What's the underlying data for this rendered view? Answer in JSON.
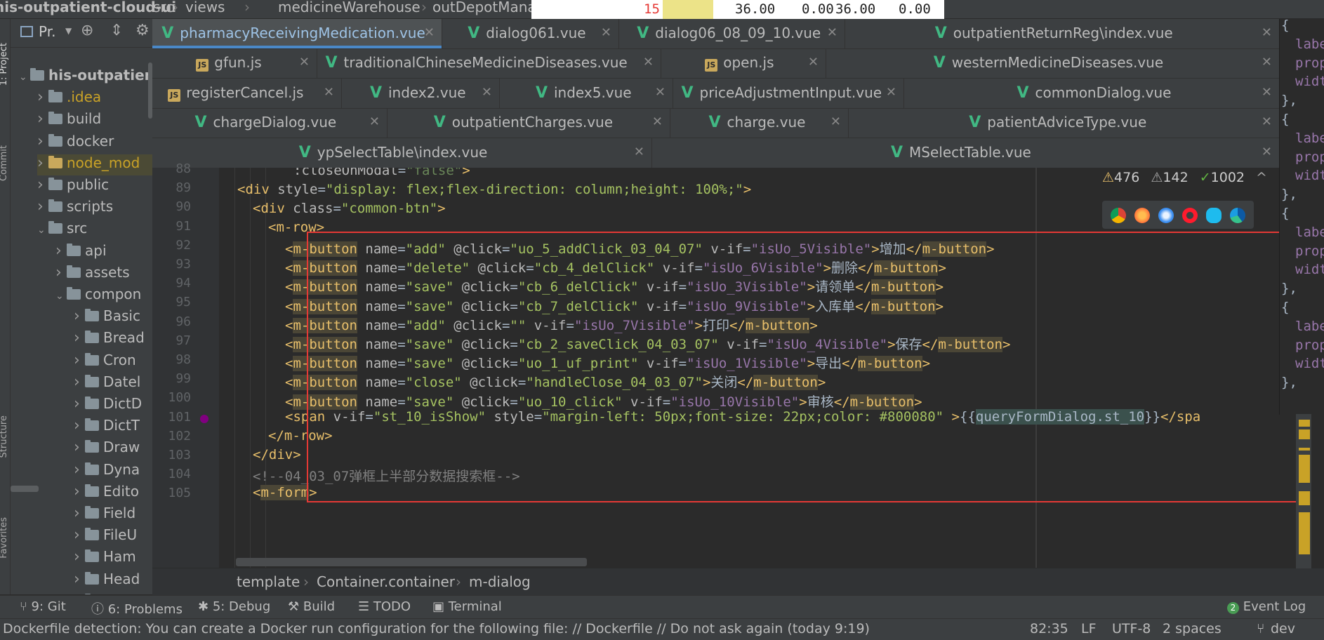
{
  "breadcrumb": [
    "his-outpatient-cloud-ui",
    "src",
    "views",
    "medicineWarehouse",
    "outDepotMana"
  ],
  "popup_row": {
    "num": "15",
    "v1": "36.00",
    "v2": "0.00",
    "v3": "36.00",
    "v4": "0.00"
  },
  "left_strip": {
    "project": "1: Project",
    "commit": "Commit",
    "structure": "Structure",
    "favorites": "Favorites"
  },
  "project_panel": {
    "title": "Pr.",
    "items": [
      {
        "label": "his-outpatien",
        "arrow": "down",
        "indent": 0,
        "color": "root"
      },
      {
        "label": ".idea",
        "arrow": "right",
        "indent": 1,
        "color": "yellow"
      },
      {
        "label": "build",
        "arrow": "right",
        "indent": 1,
        "color": "normal"
      },
      {
        "label": "docker",
        "arrow": "right",
        "indent": 1,
        "color": "normal"
      },
      {
        "label": "node_mod",
        "arrow": "right",
        "indent": 1,
        "color": "excluded"
      },
      {
        "label": "public",
        "arrow": "right",
        "indent": 1,
        "color": "normal"
      },
      {
        "label": "scripts",
        "arrow": "right",
        "indent": 1,
        "color": "normal"
      },
      {
        "label": "src",
        "arrow": "down",
        "indent": 1,
        "color": "normal"
      },
      {
        "label": "api",
        "arrow": "right",
        "indent": 2,
        "color": "normal"
      },
      {
        "label": "assets",
        "arrow": "right",
        "indent": 2,
        "color": "normal"
      },
      {
        "label": "compon",
        "arrow": "down",
        "indent": 2,
        "color": "normal"
      },
      {
        "label": "Basic",
        "arrow": "right",
        "indent": 3,
        "color": "normal"
      },
      {
        "label": "Bread",
        "arrow": "right",
        "indent": 3,
        "color": "normal"
      },
      {
        "label": "Cron",
        "arrow": "right",
        "indent": 3,
        "color": "normal"
      },
      {
        "label": "Datel",
        "arrow": "right",
        "indent": 3,
        "color": "normal"
      },
      {
        "label": "DictD",
        "arrow": "right",
        "indent": 3,
        "color": "normal"
      },
      {
        "label": "DictT",
        "arrow": "right",
        "indent": 3,
        "color": "normal"
      },
      {
        "label": "Draw",
        "arrow": "right",
        "indent": 3,
        "color": "normal"
      },
      {
        "label": "Dyna",
        "arrow": "right",
        "indent": 3,
        "color": "normal"
      },
      {
        "label": "Edito",
        "arrow": "right",
        "indent": 3,
        "color": "normal"
      },
      {
        "label": "Field",
        "arrow": "right",
        "indent": 3,
        "color": "normal"
      },
      {
        "label": "FileU",
        "arrow": "right",
        "indent": 3,
        "color": "normal"
      },
      {
        "label": "Ham",
        "arrow": "right",
        "indent": 3,
        "color": "normal"
      },
      {
        "label": "Head",
        "arrow": "right",
        "indent": 3,
        "color": "normal"
      },
      {
        "label": "IconS",
        "arrow": "right",
        "indent": 3,
        "color": "normal"
      }
    ]
  },
  "tabs": [
    [
      {
        "label": "pharmacyReceivingMedication.vue",
        "type": "vue",
        "active": true
      },
      {
        "label": "dialog061.vue",
        "type": "vue"
      },
      {
        "label": "dialog06_08_09_10.vue",
        "type": "vue"
      },
      {
        "label": "outpatientReturnReg\\index.vue",
        "type": "vue"
      }
    ],
    [
      {
        "label": "gfun.js",
        "type": "js"
      },
      {
        "label": "traditionalChineseMedicineDiseases.vue",
        "type": "vue"
      },
      {
        "label": "open.js",
        "type": "js"
      },
      {
        "label": "westernMedicineDiseases.vue",
        "type": "vue"
      }
    ],
    [
      {
        "label": "registerCancel.js",
        "type": "js"
      },
      {
        "label": "index2.vue",
        "type": "vue"
      },
      {
        "label": "index5.vue",
        "type": "vue"
      },
      {
        "label": "priceAdjustmentInput.vue",
        "type": "vue"
      },
      {
        "label": "commonDialog.vue",
        "type": "vue"
      }
    ],
    [
      {
        "label": "chargeDialog.vue",
        "type": "vue"
      },
      {
        "label": "outpatientCharges.vue",
        "type": "vue"
      },
      {
        "label": "charge.vue",
        "type": "vue"
      },
      {
        "label": "patientAdviceType.vue",
        "type": "vue"
      }
    ],
    [
      {
        "label": "ypSelectTable\\index.vue",
        "type": "vue"
      },
      {
        "label": "MSelectTable.vue",
        "type": "vue"
      }
    ]
  ],
  "inspections": {
    "warnings": "476",
    "weak_warnings": "142",
    "typos": "1002"
  },
  "line_numbers": [
    "88",
    "89",
    "90",
    "91",
    "92",
    "93",
    "94",
    "95",
    "96",
    "97",
    "98",
    "99",
    "100",
    "101",
    "102",
    "103",
    "104",
    "105"
  ],
  "code": {
    "l88": {
      "attr": ":closeOnModal",
      "val": "\"false\""
    },
    "l89": {
      "tag": "div",
      "attr": "style",
      "val": "\"display: flex;flex-direction: column;height: 100%;\""
    },
    "l90": {
      "tag": "div",
      "attr": "class",
      "val": "\"common-btn\""
    },
    "l91": {
      "tag": "m-row"
    },
    "buttons": [
      {
        "name": "\"add\"",
        "click": "\"uo_5_addClick_03_04_07\"",
        "vif": "\"isUo_5Visible\"",
        "text": "增加"
      },
      {
        "name": "\"delete\"",
        "click": "\"cb_4_delClick\"",
        "vif": "\"isUo_6Visible\"",
        "text": "删除"
      },
      {
        "name": "\"save\"",
        "click": "\"cb_6_delClick\"",
        "vif": "\"isUo_3Visible\"",
        "text": "请领单"
      },
      {
        "name": "\"save\"",
        "click": "\"cb_7_delClick\"",
        "vif": "\"isUo_9Visible\"",
        "text": "入库单"
      },
      {
        "name": "\"add\"",
        "click": "\"\"",
        "vif": "\"isUo_7Visible\"",
        "text": "打印"
      },
      {
        "name": "\"save\"",
        "click": "\"cb_2_saveClick_04_03_07\"",
        "vif": "\"isUo_4Visible\"",
        "text": "保存"
      },
      {
        "name": "\"save\"",
        "click": "\"uo_1_uf_print\"",
        "vif": "\"isUo_1Visible\"",
        "text": "导出"
      },
      {
        "name": "\"close\"",
        "click": "\"handleClose_04_03_07\"",
        "vif": "",
        "text": "关闭"
      },
      {
        "name": "\"save\"",
        "click": "\"uo_10_click\"",
        "vif": "\"isUo_10Visible\"",
        "text": "审核"
      }
    ],
    "l101": {
      "vif": "\"st_10_isShow\"",
      "style": "\"margin-left: 50px;font-size: 22px;color: #800080\"",
      "expr": "queryFormDialog.st_10",
      "close": "spa"
    },
    "l102": "m-row",
    "l103": "div",
    "l104": "<!--04_03_07弹框上半部分数据搜索框-->",
    "l105": "m-form"
  },
  "right_code": [
    "{",
    "labe",
    "prop",
    "widt",
    "},",
    "{",
    "labe",
    "prop",
    "widt",
    "},",
    "{",
    "labe",
    "prop",
    "widt",
    "},",
    "{",
    "labe",
    "prop",
    "widt",
    "},"
  ],
  "editor_breadcrumb": [
    "template",
    "Container.container",
    "m-dialog"
  ],
  "tool_windows": {
    "git": "9: Git",
    "problems": "6: Problems",
    "debug": "5: Debug",
    "build": "Build",
    "todo": "TODO",
    "terminal": "Terminal",
    "event_log_count": "2",
    "event_log": "Event Log"
  },
  "status": {
    "message": "Dockerfile detection: You can create a Docker run configuration for the following file: // Dockerfile // Do not ask again (today 9:19)",
    "position": "82:35",
    "line_sep": "LF",
    "encoding": "UTF-8",
    "indent": "2 spaces",
    "branch": "dev"
  },
  "colors": {
    "tag": "#e8bf6a",
    "string": "#6a8759",
    "vif_value": "#9876aa",
    "highlight_box": "#e53935",
    "active_tab": "#4a88c7"
  }
}
